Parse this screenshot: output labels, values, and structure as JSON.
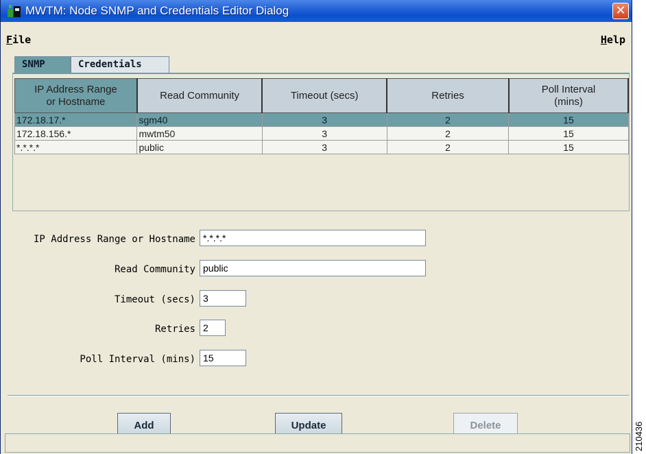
{
  "window": {
    "title": "MWTM: Node SNMP and Credentials Editor Dialog",
    "close_glyph": "✕"
  },
  "menu": {
    "file_key": "F",
    "file_rest": "ile",
    "help_key": "H",
    "help_rest": "elp"
  },
  "tabs": [
    {
      "label": "SNMP",
      "active": true
    },
    {
      "label": "Credentials",
      "active": false
    }
  ],
  "table": {
    "headers": [
      "IP Address Range\nor Hostname",
      "Read Community",
      "Timeout (secs)",
      "Retries",
      "Poll Interval\n(mins)"
    ],
    "header_lines": [
      [
        "IP Address Range",
        "or Hostname"
      ],
      [
        "Read Community"
      ],
      [
        "Timeout (secs)"
      ],
      [
        "Retries"
      ],
      [
        "Poll Interval",
        "(mins)"
      ]
    ],
    "rows": [
      {
        "ip": "172.18.17.*",
        "community": "sgm40",
        "timeout": "3",
        "retries": "2",
        "poll": "15",
        "selected": true
      },
      {
        "ip": "172.18.156.*",
        "community": "mwtm50",
        "timeout": "3",
        "retries": "2",
        "poll": "15",
        "selected": false
      },
      {
        "ip": "*.*.*.*",
        "community": "public",
        "timeout": "3",
        "retries": "2",
        "poll": "15",
        "selected": false
      }
    ]
  },
  "form": {
    "ip_label": "IP Address Range or Hostname",
    "ip_value": "*.*.*.*",
    "community_label": "Read Community",
    "community_value": "public",
    "timeout_label": "Timeout (secs)",
    "timeout_value": "3",
    "retries_label": "Retries",
    "retries_value": "2",
    "poll_label": "Poll Interval (mins)",
    "poll_value": "15"
  },
  "buttons": {
    "add": "Add",
    "update": "Update",
    "delete": "Delete"
  },
  "side_text": "210436",
  "colors": {
    "titlebar": "#0b4fcf",
    "selection": "#6d9ea6",
    "close": "#d4411e"
  }
}
